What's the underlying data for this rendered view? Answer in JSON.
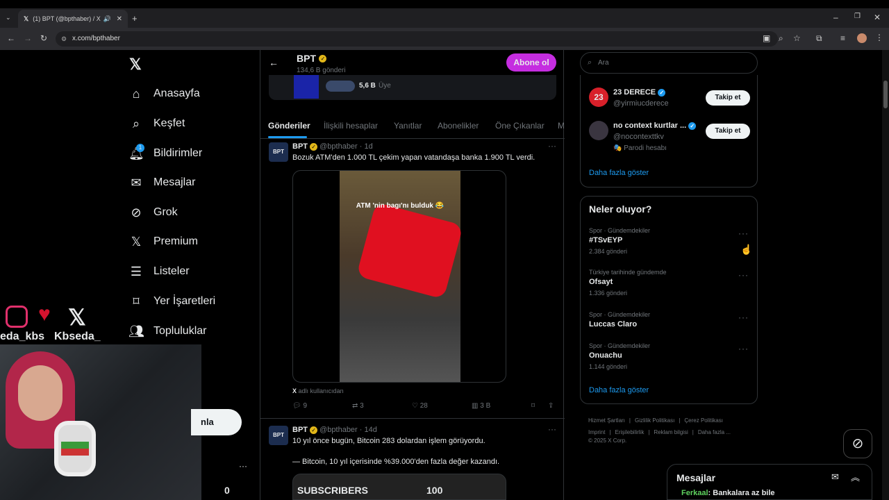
{
  "browser": {
    "tab_title": "(1) BPT (@bpthaber) / X",
    "url": "x.com/bpthaber"
  },
  "nav": {
    "items": [
      {
        "label": "Anasayfa",
        "icon": "home-icon"
      },
      {
        "label": "Keşfet",
        "icon": "search-icon"
      },
      {
        "label": "Bildirimler",
        "icon": "bell-icon",
        "badge": "1"
      },
      {
        "label": "Mesajlar",
        "icon": "mail-icon"
      },
      {
        "label": "Grok",
        "icon": "grok-icon"
      },
      {
        "label": "Premium",
        "icon": "x-logo-icon"
      },
      {
        "label": "Listeler",
        "icon": "list-icon"
      },
      {
        "label": "Yer İşaretleri",
        "icon": "bookmark-icon"
      },
      {
        "label": "Topluluklar",
        "icon": "people-icon"
      }
    ],
    "post_button_partial": "nla",
    "more_dots": "···"
  },
  "overlay": {
    "handle_left": "eda_kbs",
    "handle_right": "Kbseda_",
    "subscribers_label": "SUBSCRIBERS",
    "subscribers_value": "100",
    "zero": "0"
  },
  "profile": {
    "name": "BPT",
    "posts_count": "134,6 B gönderi",
    "subscribe_label": "Abone ol",
    "members_count": "5,6 B",
    "members_label": "Üye"
  },
  "tabs": [
    "Gönderiler",
    "İlişkili hesaplar",
    "Yanıtlar",
    "Abonelikler",
    "Öne Çıkanlar",
    "M"
  ],
  "tweets": [
    {
      "name": "BPT",
      "handle": "@bpthaber",
      "time": "1d",
      "text": "Bozuk ATM'den 1.000 TL çekim yapan vatandaşa banka 1.900 TL verdi.",
      "media_caption": "ATM 'nin bagı'nı bulduk 😂",
      "attribution": "adlı kullanıcıdan",
      "attribution_prefix": "X",
      "replies": "9",
      "retweets": "3",
      "likes": "28",
      "views": "3 B"
    },
    {
      "name": "BPT",
      "handle": "@bpthaber",
      "time": "14d",
      "text": "10 yıl önce bugün, Bitcoin 283 dolardan işlem görüyordu.",
      "text2": "— Bitcoin, 10 yıl içerisinde %39.000'den fazla değer kazandı."
    }
  ],
  "search": {
    "placeholder": "Ara"
  },
  "who_to_follow": {
    "accounts": [
      {
        "name": "23 DERECE",
        "handle": "@yirmiucderece",
        "follow": "Takip et"
      },
      {
        "name": "no context kurtlar ...",
        "handle": "@nocontexttkv",
        "follow": "Takip et",
        "note": "Parodi hesabı"
      }
    ],
    "show_more": "Daha fazla göster"
  },
  "trends": {
    "title": "Neler oluyor?",
    "items": [
      {
        "category": "Spor · Gündemdekiler",
        "name": "#TSvEYP",
        "count": "2.384 gönderi"
      },
      {
        "category": "Türkiye tarihinde gündemde",
        "name": "Ofsayt",
        "count": "1.336 gönderi"
      },
      {
        "category": "Spor · Gündemdekiler",
        "name": "Luccas Claro",
        "count": ""
      },
      {
        "category": "Spor · Gündemdekiler",
        "name": "Onuachu",
        "count": "1.144 gönderi"
      }
    ],
    "show_more": "Daha fazla göster"
  },
  "footer": {
    "links": [
      "Hizmet Şartları",
      "Gizlilik Politikası",
      "Çerez Politikası",
      "Imprint",
      "Erişilebilirlik",
      "Reklam bilgisi",
      "Daha fazla ..."
    ],
    "copyright": "© 2025 X Corp."
  },
  "messages": {
    "title": "Mesajlar",
    "chat_user": "Ferkaal",
    "chat_text": ": Bankalara az bile"
  }
}
